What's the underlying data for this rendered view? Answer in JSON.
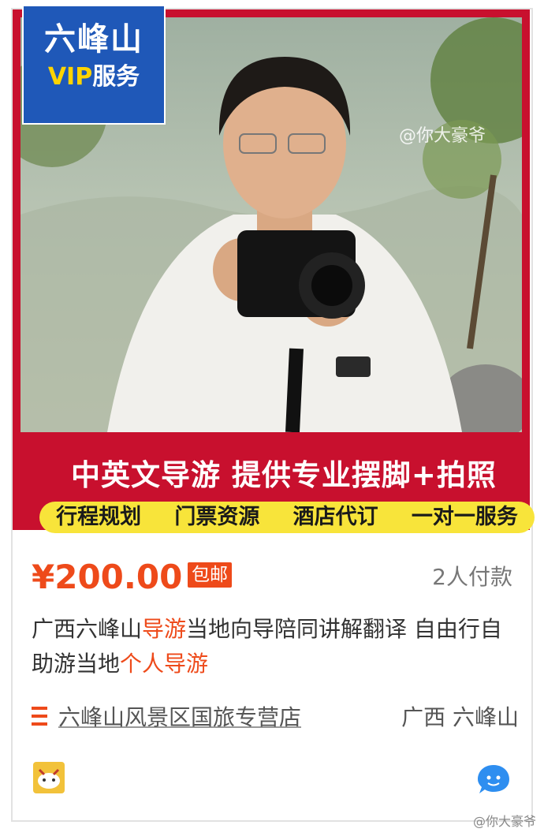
{
  "hero": {
    "vip_title": "六峰山",
    "vip_label": "VIP",
    "vip_service": "服务",
    "watermark": "@你大豪爷",
    "headline": "中英文导游 提供专业摆脚+拍照",
    "tags": [
      "行程规划",
      "门票资源",
      "酒店代订",
      "一对一服务"
    ]
  },
  "listing": {
    "price": "¥200.00",
    "shipping_badge": "包邮",
    "paid_count": "2人付款",
    "title_parts": [
      "广西六峰山",
      "导游",
      "当地向导陪同讲解翻译 自由行自助游当地",
      "个人导游"
    ],
    "shop_name": "六峰山风景区国旅专营店",
    "location": "广西 六峰山"
  },
  "footer": {
    "watermark": "@你大豪爷"
  },
  "colors": {
    "brand_red": "#c8102e",
    "price_orange": "#ee4a1a",
    "badge_blue": "#1f58b8",
    "tag_yellow": "#f8e43a"
  },
  "icons": [
    "menu-lines-icon",
    "pig-logo-icon",
    "chat-bubble-icon"
  ]
}
